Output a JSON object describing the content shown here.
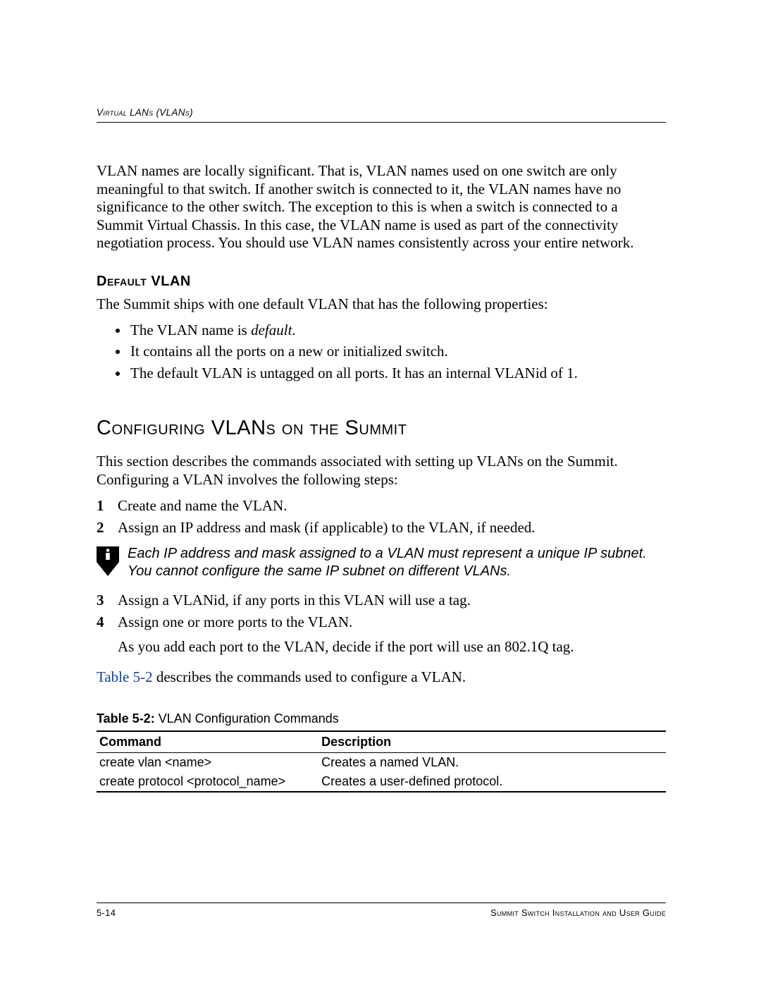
{
  "running_head": "Virtual LANs (VLANs)",
  "para1": "VLAN names are locally significant. That is, VLAN names used on one switch are only meaningful to that switch. If another switch is connected to it, the VLAN names have no significance to the other switch. The exception to this is when a switch is connected to a Summit Virtual Chassis. In this case, the VLAN name is used as part of the connectivity negotiation process. You should use VLAN names consistently across your entire network.",
  "h3_default_vlan": "Default VLAN",
  "default_intro": "The Summit ships with one default VLAN that has the following properties:",
  "bullets": {
    "b1_pre": "The VLAN name is ",
    "b1_em": "default",
    "b1_post": ".",
    "b2": "It contains all the ports on a new or initialized switch.",
    "b3": "The default VLAN is untagged on all ports. It has an internal VLANid of 1."
  },
  "h2_config": "Configuring VLANs on the Summit",
  "config_intro": "This section describes the commands associated with setting up VLANs on the Summit. Configuring a VLAN involves the following steps:",
  "steps": {
    "s1": "Create and name the VLAN.",
    "s2": "Assign an IP address and mask (if applicable) to the VLAN, if needed.",
    "s3": "Assign a VLANid, if any ports in this VLAN will use a tag.",
    "s4": "Assign one or more ports to the VLAN."
  },
  "note_text": "Each IP address and mask assigned to a VLAN must represent a unique IP subnet. You cannot configure the same IP subnet on different VLANs.",
  "sub_step": "As you add each port to the VLAN, decide if the port will use an 802.1Q tag.",
  "ref_link": "Table 5-2",
  "ref_rest": " describes the commands used to configure a VLAN.",
  "table": {
    "caption_label": "Table 5-2:",
    "caption_text": "  VLAN Configuration Commands",
    "head_cmd": "Command",
    "head_desc": "Description",
    "rows": [
      {
        "cmd": "create vlan <name>",
        "desc": "Creates a named VLAN."
      },
      {
        "cmd": "create protocol <protocol_name>",
        "desc": "Creates a user-defined protocol."
      }
    ]
  },
  "footer": {
    "page_num": "5-14",
    "book_title": "Summit Switch Installation and User Guide"
  }
}
